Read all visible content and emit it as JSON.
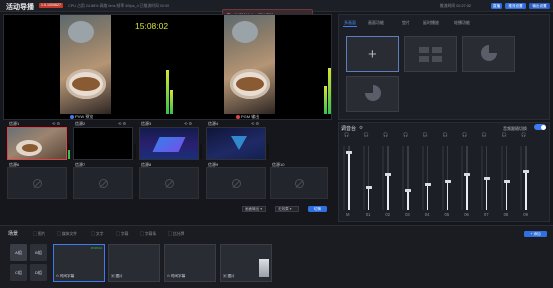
{
  "app": {
    "title": "活动导播",
    "edition": "1.0.1000627",
    "stats": "CPU 占用 24.88%   网络 0ms   帧率 30fps_4   已推流时间 00:00"
  },
  "toast": {
    "message": "依据推流中，无法删除"
  },
  "topbar": {
    "clock_label": "推流时间 02:27:32",
    "btn_1": "直播",
    "btn_2": "推流设置",
    "btn_3": "输出设置"
  },
  "monitor": {
    "clock": "15:08:02",
    "pvw_label": "PVW 预览",
    "pgm_label": "PGM 输出"
  },
  "sources": {
    "slots": [
      {
        "label": "信源1"
      },
      {
        "label": "信源2"
      },
      {
        "label": "信源3"
      },
      {
        "label": "信源4"
      },
      {
        "label": "信源5"
      },
      {
        "label": "信源6"
      },
      {
        "label": "信源7"
      },
      {
        "label": "信源8"
      },
      {
        "label": "信源9"
      },
      {
        "label": "信源10"
      }
    ],
    "output_select": "画面输出",
    "effect_select": "无效果",
    "switch_label": "切换"
  },
  "layout_panel": {
    "tabs": [
      "多画面",
      "画面功能",
      "垫片",
      "延时播放",
      "轮播功能"
    ],
    "active_tab": 0
  },
  "mixer": {
    "title": "调音台",
    "follow_label": "音频跟随切换",
    "follow_on": true,
    "channels": [
      {
        "label": "M",
        "level": 0.9
      },
      {
        "label": "01",
        "level": 0.35
      },
      {
        "label": "02",
        "level": 0.55
      },
      {
        "label": "03",
        "level": 0.3
      },
      {
        "label": "04",
        "level": 0.4
      },
      {
        "label": "05",
        "level": 0.45
      },
      {
        "label": "06",
        "level": 0.55
      },
      {
        "label": "07",
        "level": 0.5
      },
      {
        "label": "08",
        "level": 0.45
      },
      {
        "label": "09",
        "level": 0.6
      }
    ]
  },
  "scene": {
    "title": "场景",
    "buttons": [
      "A组",
      "B组",
      "C组",
      "D组"
    ],
    "tools": [
      "图片",
      "媒体文件",
      "文字",
      "字幕",
      "字幕条",
      "比分牌"
    ],
    "add_label": "+ 添加",
    "thumbs": [
      {
        "label": "时间字幕"
      },
      {
        "label": "图片"
      },
      {
        "label": "时间字幕"
      },
      {
        "label": "图片"
      }
    ]
  },
  "colors": {
    "accent": "#3d7bf0",
    "record": "#e04545",
    "clock": "#d7e23a"
  }
}
